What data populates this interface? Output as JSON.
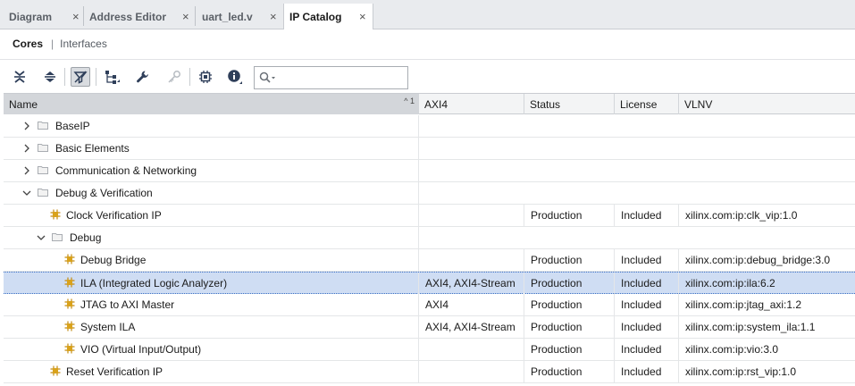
{
  "tabs": [
    {
      "label": "Diagram",
      "active": false
    },
    {
      "label": "Address Editor",
      "active": false
    },
    {
      "label": "uart_led.v",
      "active": false
    },
    {
      "label": "IP Catalog",
      "active": true
    }
  ],
  "tab_close_glyph": "×",
  "subheader": {
    "cores": "Cores",
    "separator": "|",
    "interfaces": "Interfaces"
  },
  "toolbar": {
    "icons": [
      "collapse-all-icon",
      "expand-all-icon",
      "filter-icon",
      "hierarchy-icon",
      "customize-ip-icon",
      "license-key-icon",
      "chip-icon",
      "info-icon"
    ],
    "search_placeholder": ""
  },
  "table": {
    "columns": {
      "name": "Name",
      "sort_indicator": "^ 1",
      "axi4": "AXI4",
      "status": "Status",
      "license": "License",
      "vlnv": "VLNV"
    },
    "rows": [
      {
        "type": "folder",
        "expanded": false,
        "name": "BaseIP",
        "axi4": "",
        "status": "",
        "license": "",
        "vlnv": ""
      },
      {
        "type": "folder",
        "expanded": false,
        "name": "Basic Elements",
        "axi4": "",
        "status": "",
        "license": "",
        "vlnv": ""
      },
      {
        "type": "folder",
        "expanded": false,
        "name": "Communication & Networking",
        "axi4": "",
        "status": "",
        "license": "",
        "vlnv": ""
      },
      {
        "type": "folder",
        "expanded": true,
        "name": "Debug & Verification",
        "axi4": "",
        "status": "",
        "license": "",
        "vlnv": ""
      },
      {
        "type": "ip",
        "name": "Clock Verification IP",
        "axi4": "",
        "status": "Production",
        "license": "Included",
        "vlnv": "xilinx.com:ip:clk_vip:1.0"
      },
      {
        "type": "folder",
        "expanded": true,
        "name": "Debug",
        "axi4": "",
        "status": "",
        "license": "",
        "vlnv": ""
      },
      {
        "type": "ip",
        "name": "Debug Bridge",
        "axi4": "",
        "status": "Production",
        "license": "Included",
        "vlnv": "xilinx.com:ip:debug_bridge:3.0"
      },
      {
        "type": "ip",
        "name": "ILA (Integrated Logic Analyzer)",
        "axi4": "AXI4, AXI4-Stream",
        "status": "Production",
        "license": "Included",
        "vlnv": "xilinx.com:ip:ila:6.2",
        "selected": true
      },
      {
        "type": "ip",
        "name": "JTAG to AXI Master",
        "axi4": "AXI4",
        "status": "Production",
        "license": "Included",
        "vlnv": "xilinx.com:ip:jtag_axi:1.2"
      },
      {
        "type": "ip",
        "name": "System ILA",
        "axi4": "AXI4, AXI4-Stream",
        "status": "Production",
        "license": "Included",
        "vlnv": "xilinx.com:ip:system_ila:1.1"
      },
      {
        "type": "ip",
        "name": "VIO (Virtual Input/Output)",
        "axi4": "",
        "status": "Production",
        "license": "Included",
        "vlnv": "xilinx.com:ip:vio:3.0"
      },
      {
        "type": "ip",
        "name": "Reset Verification IP",
        "axi4": "",
        "status": "Production",
        "license": "Included",
        "vlnv": "xilinx.com:ip:rst_vip:1.0"
      }
    ]
  },
  "colors": {
    "selected_row": "#cfddf3",
    "ip_icon": "#d9a21b",
    "tab_bar": "#e9ebee"
  }
}
